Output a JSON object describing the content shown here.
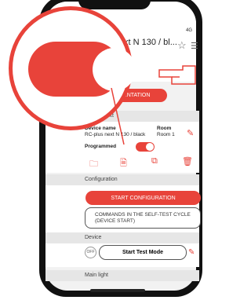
{
  "status": {
    "signal": "4G"
  },
  "header": {
    "title": "RC-plus next N 130 / bl...",
    "doc_button": "DOCUMENTATION"
  },
  "project": {
    "section_title": "New projekt",
    "device_name_label": "Device name",
    "device_name_value": "RC-plus next N 130 / black",
    "room_label": "Room",
    "room_value": "Room 1",
    "programmed_label": "Programmed",
    "programmed": true
  },
  "configuration": {
    "section_title": "Configuration",
    "start_button": "START CONFIGURATION",
    "commands_text_1": "COMMANDS IN THE SELF-TEST CYCLE",
    "commands_text_2": "(DEVICE START)"
  },
  "device": {
    "section_title": "Device",
    "off_label": "OFF",
    "test_button": "Start Test Mode"
  },
  "main_light": {
    "section_title": "Main light"
  },
  "colors": {
    "accent": "#e8433a"
  },
  "icons": {
    "folder": "folder-icon",
    "document": "document-icon",
    "copy": "copy-icon",
    "trash": "trash-icon",
    "star": "star-icon",
    "menu": "menu-icon",
    "edit": "pencil-icon"
  }
}
